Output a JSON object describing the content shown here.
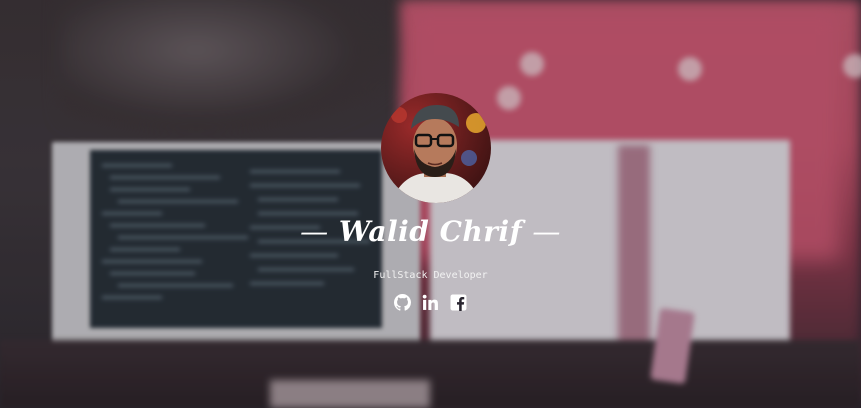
{
  "profile": {
    "name": "Walid Chrif",
    "name_prefix": "—",
    "name_suffix": "—",
    "role": "FullStack Developer"
  },
  "socials": [
    {
      "icon": "github-icon",
      "label": "GitHub"
    },
    {
      "icon": "linkedin-icon",
      "label": "in"
    },
    {
      "icon": "facebook-icon",
      "label": "f"
    }
  ],
  "colors": {
    "text": "#ffffff",
    "background_pink": "#d35b76",
    "background_dark": "#3b3437"
  }
}
